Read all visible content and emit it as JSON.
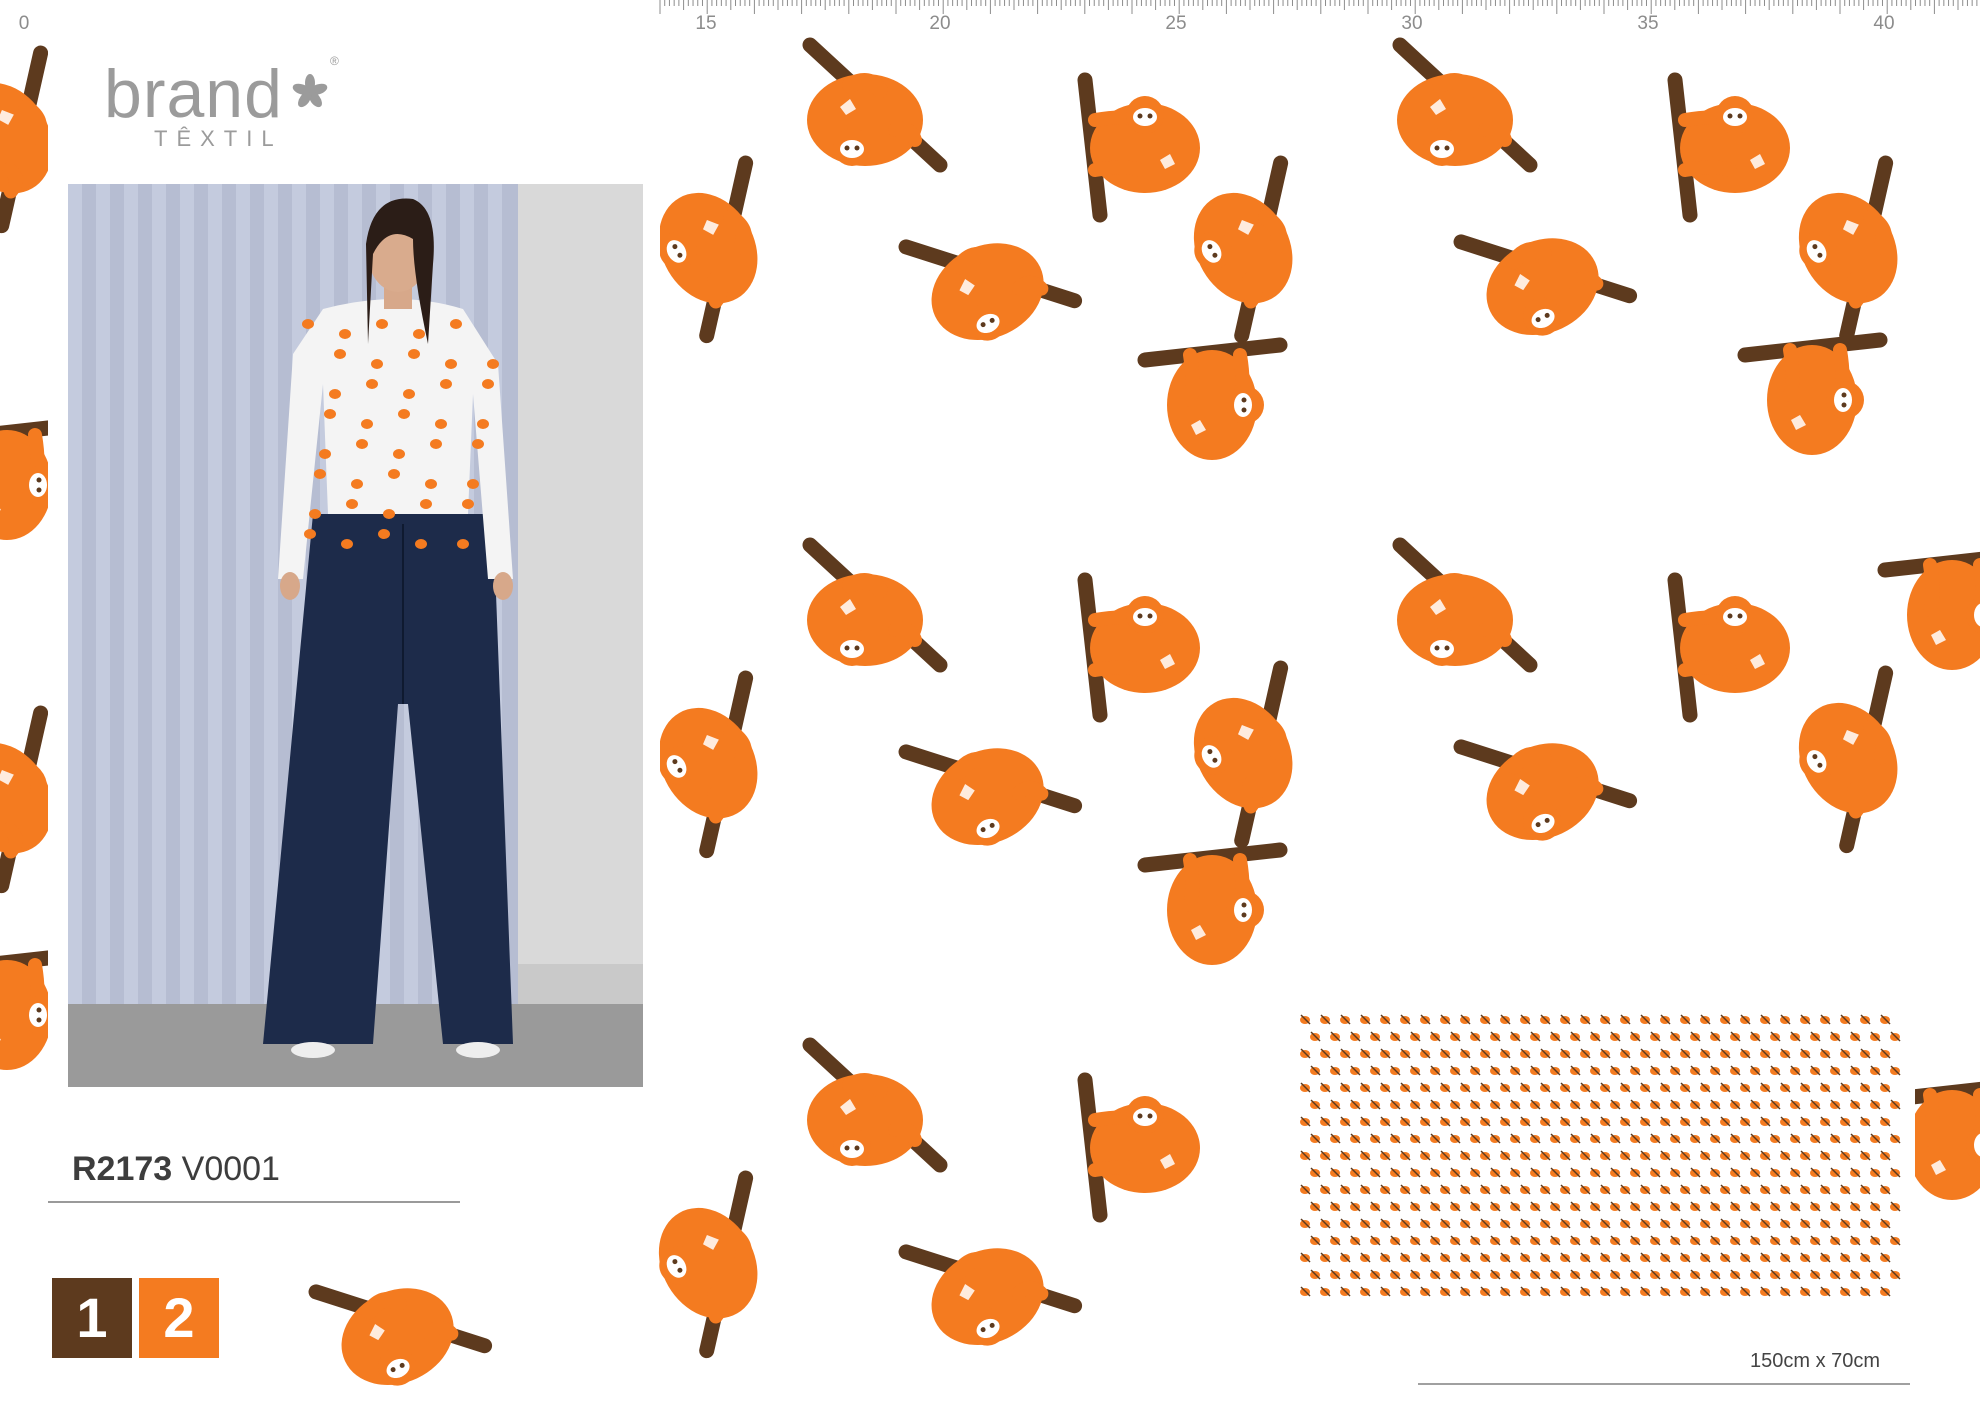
{
  "brand": {
    "name": "brand",
    "subtitle": "TÊXTIL",
    "registered": "®"
  },
  "ruler": {
    "labels": [
      "0",
      "15",
      "20",
      "25",
      "30",
      "35",
      "40"
    ]
  },
  "product": {
    "ref": "R2173",
    "variant": "V0001"
  },
  "badges": {
    "first": "1",
    "second": "2"
  },
  "swatch": {
    "size_label": "150cm x 70cm"
  },
  "colors": {
    "sloth_orange": "#f47b20",
    "branch_brown": "#5d3a1e",
    "denim": "#1d2b4a",
    "curtain": "#b9c1d6",
    "text_gray": "#9b9b9b"
  },
  "icons": {
    "pattern_motif": "sloth-icon",
    "logo_mark": "flower-icon"
  }
}
